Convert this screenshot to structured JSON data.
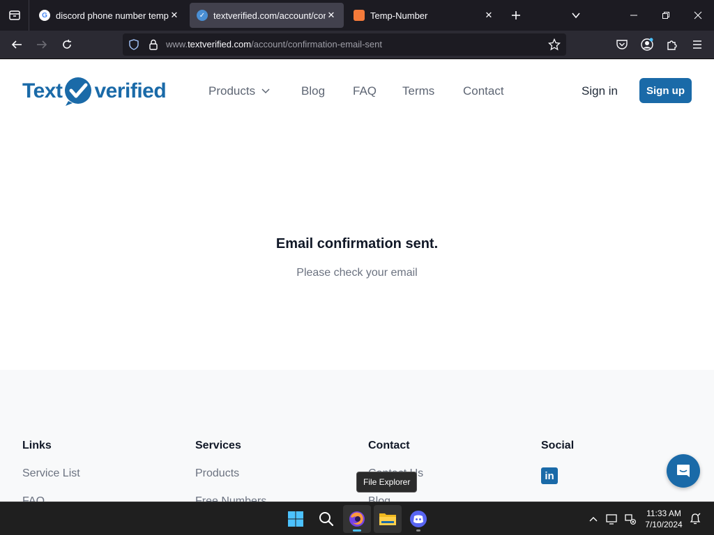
{
  "browser": {
    "tabs": [
      {
        "title": "discord phone number temp - G",
        "favicon": "google-icon",
        "active": false
      },
      {
        "title": "textverified.com/account/confi",
        "favicon": "textverified-icon",
        "active": true
      },
      {
        "title": "Temp-Number",
        "favicon": "temp-number-icon",
        "active": false
      }
    ],
    "url": {
      "prefix": "www.",
      "host": "textverified.com",
      "path": "/account/confirmation-email-sent"
    }
  },
  "site": {
    "logo": {
      "left": "Text",
      "right": "verified",
      "brand_color": "#1a6aa8"
    },
    "nav": {
      "products": "Products",
      "blog": "Blog",
      "faq": "FAQ",
      "terms": "Terms",
      "contact": "Contact"
    },
    "signin": "Sign in",
    "signup": "Sign up"
  },
  "main": {
    "title": "Email confirmation sent.",
    "subtitle": "Please check your email"
  },
  "footer": {
    "links": {
      "heading": "Links",
      "items": [
        "Service List",
        "FAQ"
      ]
    },
    "services": {
      "heading": "Services",
      "items": [
        "Products",
        "Free Numbers"
      ]
    },
    "contact": {
      "heading": "Contact",
      "items": [
        "Contact Us",
        "Blog"
      ]
    },
    "social": {
      "heading": "Social",
      "items": [
        "linkedin-icon"
      ]
    }
  },
  "tooltip": "File Explorer",
  "taskbar": {
    "apps": [
      "start-icon",
      "search-icon",
      "firefox-icon",
      "file-explorer-icon",
      "discord-icon"
    ],
    "time": "11:33 AM",
    "date": "7/10/2024"
  }
}
